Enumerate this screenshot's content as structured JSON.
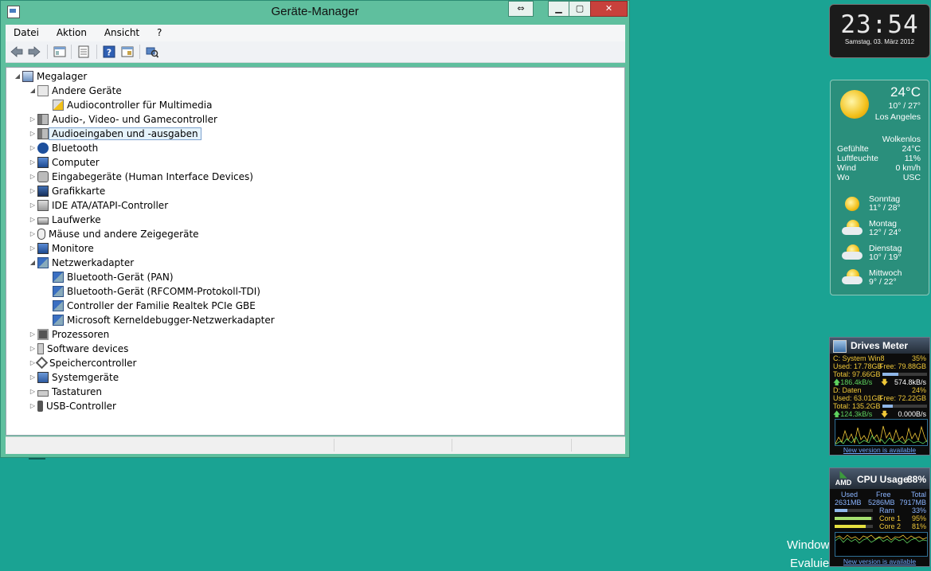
{
  "window": {
    "title": "Geräte-Manager",
    "menu": [
      "Datei",
      "Aktion",
      "Ansicht",
      "?"
    ],
    "close_glyph": "✕",
    "min_glyph": "▁",
    "max_glyph": "▢",
    "snap_glyph": "⇔"
  },
  "tree": [
    {
      "label": "Megalager",
      "level": 0,
      "exp": "◢",
      "icon": "computer-icon"
    },
    {
      "label": "Andere Geräte",
      "level": 1,
      "exp": "◢",
      "icon": "unknown-device-icon"
    },
    {
      "label": "Audiocontroller für Multimedia",
      "level": 2,
      "exp": "",
      "icon": "warning-device-icon"
    },
    {
      "label": "Audio-, Video- und Gamecontroller",
      "level": 1,
      "exp": "▷",
      "icon": "speaker-icon"
    },
    {
      "label": "Audioeingaben und -ausgaben",
      "level": 1,
      "exp": "▷",
      "icon": "speaker-icon",
      "selected": true
    },
    {
      "label": "Bluetooth",
      "level": 1,
      "exp": "▷",
      "icon": "bluetooth-icon"
    },
    {
      "label": "Computer",
      "level": 1,
      "exp": "▷",
      "icon": "monitor-icon"
    },
    {
      "label": "Eingabegeräte (Human Interface Devices)",
      "level": 1,
      "exp": "▷",
      "icon": "hid-icon"
    },
    {
      "label": "Grafikkarte",
      "level": 1,
      "exp": "▷",
      "icon": "display-adapter-icon"
    },
    {
      "label": "IDE ATA/ATAPI-Controller",
      "level": 1,
      "exp": "▷",
      "icon": "ide-icon"
    },
    {
      "label": "Laufwerke",
      "level": 1,
      "exp": "▷",
      "icon": "drive-icon"
    },
    {
      "label": "Mäuse und andere Zeigegeräte",
      "level": 1,
      "exp": "▷",
      "icon": "mouse-icon"
    },
    {
      "label": "Monitore",
      "level": 1,
      "exp": "▷",
      "icon": "monitor-icon"
    },
    {
      "label": "Netzwerkadapter",
      "level": 1,
      "exp": "◢",
      "icon": "network-icon"
    },
    {
      "label": "Bluetooth-Gerät (PAN)",
      "level": 2,
      "exp": "",
      "icon": "network-icon"
    },
    {
      "label": "Bluetooth-Gerät (RFCOMM-Protokoll-TDI)",
      "level": 2,
      "exp": "",
      "icon": "network-icon"
    },
    {
      "label": "Controller der Familie Realtek PCIe GBE",
      "level": 2,
      "exp": "",
      "icon": "network-icon"
    },
    {
      "label": "Microsoft Kerneldebugger-Netzwerkadapter",
      "level": 2,
      "exp": "",
      "icon": "network-icon"
    },
    {
      "label": "Prozessoren",
      "level": 1,
      "exp": "▷",
      "icon": "cpu-icon"
    },
    {
      "label": "Software devices",
      "level": 1,
      "exp": "▷",
      "icon": "software-device-icon"
    },
    {
      "label": "Speichercontroller",
      "level": 1,
      "exp": "▷",
      "icon": "storage-controller-icon"
    },
    {
      "label": "Systemgeräte",
      "level": 1,
      "exp": "▷",
      "icon": "system-device-icon"
    },
    {
      "label": "Tastaturen",
      "level": 1,
      "exp": "▷",
      "icon": "keyboard-icon"
    },
    {
      "label": "USB-Controller",
      "level": 1,
      "exp": "▷",
      "icon": "usb-icon"
    }
  ],
  "clock": {
    "time": "23:54",
    "date": "Samstag, 03. März 2012"
  },
  "weather": {
    "temp": "24°C",
    "range": "10° / 27°",
    "city": "Los Angeles",
    "condition": "Wolkenlos",
    "details": [
      [
        "Gefühlte",
        "24°C"
      ],
      [
        "Luftfeuchte",
        "11%"
      ],
      [
        "Wind",
        "0 km/h"
      ],
      [
        "Wo",
        "USC"
      ]
    ],
    "forecast": [
      [
        "Sonntag",
        "11° / 28°"
      ],
      [
        "Montag",
        "12° / 24°"
      ],
      [
        "Dienstag",
        "10° / 19°"
      ],
      [
        "Mittwoch",
        "9° / 22°"
      ]
    ]
  },
  "drives": {
    "title": "Drives Meter",
    "c": {
      "name": "C: System Win8",
      "pct": "35%",
      "used": "Used: 17.78GB",
      "free": "Free: 79.88GB",
      "total": "Total: 97.66GB",
      "up": "186.4kB/s",
      "down": "574.8kB/s",
      "fill": 0.35
    },
    "d": {
      "name": "D: Daten",
      "pct": "24%",
      "used": "Used: 63.01GB",
      "free": "Free: 72.22GB",
      "total": "Total: 135.2GB",
      "up": "124.3kB/s",
      "down": "0.000B/s",
      "fill": 0.24
    },
    "new_version": "New version is available"
  },
  "cpu": {
    "title": "CPU Usage",
    "pct": "88%",
    "brand": "AMD",
    "hdr": [
      "Used",
      "Free",
      "Total"
    ],
    "vals": [
      "2631MB",
      "5286MB",
      "7917MB"
    ],
    "rows": [
      [
        "Ram",
        "33%",
        0.33
      ],
      [
        "Core 1",
        "95%",
        0.95
      ],
      [
        "Core 2",
        "81%",
        0.81
      ]
    ],
    "new_version": "New version is available"
  },
  "desktop": {
    "wm1": "Window",
    "wm2": "Evaluie",
    "bg": "Win"
  },
  "colors": {
    "desktop": "#1aa393",
    "title_bar": "#5fbf9e",
    "close": "#c8413c",
    "selection": "#e5f3fb"
  }
}
